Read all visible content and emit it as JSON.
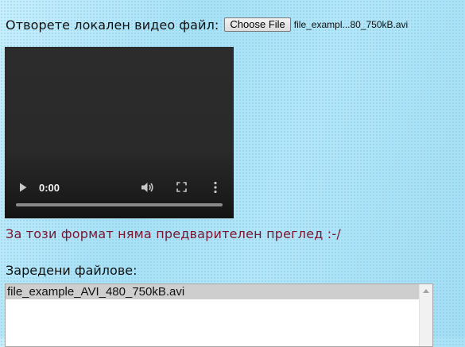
{
  "open_file": {
    "label": "Отворете локален видео файл:",
    "button_label": "Choose File",
    "selected_file": "file_exampl...80_750kB.avi"
  },
  "video": {
    "time": "0:00",
    "progress": 0,
    "icons": [
      "play-icon",
      "volume-icon",
      "fullscreen-icon",
      "more-options-icon"
    ]
  },
  "messages": {
    "no_preview": "За този формат няма предварителен преглед :-/"
  },
  "loaded_files": {
    "label": "Заредени файлове:",
    "items": [
      "file_example_AVI_480_750kB.avi"
    ]
  },
  "colors": {
    "background": "#b3e4f5",
    "warning_text": "#7a1530",
    "selected_item": "#cecece"
  }
}
